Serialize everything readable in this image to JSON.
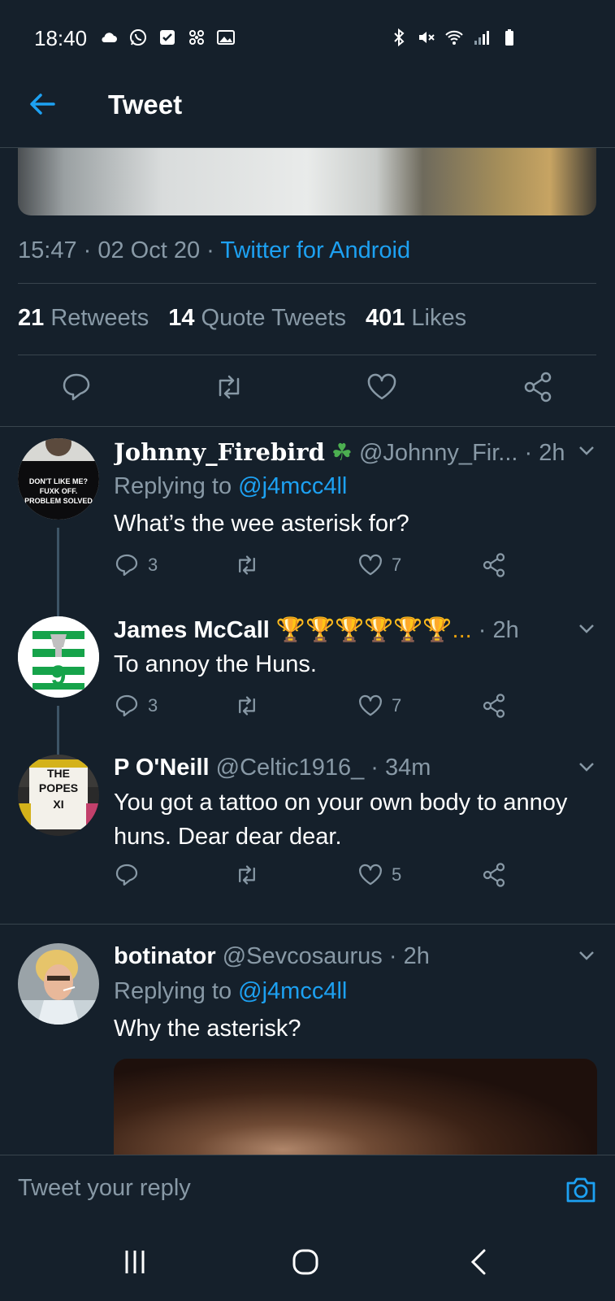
{
  "status_bar": {
    "time": "18:40",
    "left_icons": [
      "cloud-icon",
      "whatsapp-icon",
      "check-box-icon",
      "pinwheel-icon",
      "image-icon"
    ],
    "right_icons": [
      "bluetooth-icon",
      "mute-icon",
      "wifi-icon",
      "signal-icon",
      "battery-icon"
    ]
  },
  "header": {
    "title": "Tweet",
    "back_icon": "arrow-left-icon"
  },
  "tweet": {
    "time": "15:47",
    "sep1": " · ",
    "date": "02 Oct 20",
    "sep2": " · ",
    "source": "Twitter for Android",
    "stats": {
      "retweets_count": "21",
      "retweets_label": "Retweets",
      "quotes_count": "14",
      "quotes_label": "Quote Tweets",
      "likes_count": "401",
      "likes_label": "Likes"
    },
    "action_icons": [
      "reply-icon",
      "retweet-icon",
      "like-icon",
      "share-icon"
    ]
  },
  "replies": [
    {
      "name": "Johnny_Firebird",
      "name_emoji": "☘",
      "handle": "@Johnny_Fir...",
      "dot": " · ",
      "time": "2h",
      "replying_label": "Replying to",
      "replying_to": "@j4mcc4ll",
      "text": "What’s the wee asterisk for?",
      "reply_count": "3",
      "retweet_count": "",
      "like_count": "7",
      "avatar_text": [
        "DON'T LIKE ME?",
        "FUXK OFF.",
        "PROBLEM SOLVED"
      ]
    },
    {
      "name": "James McCall",
      "name_emoji": "🏆🏆🏆🏆🏆🏆...",
      "dot": " · ",
      "time": "2h",
      "text": "To annoy the Huns.",
      "reply_count": "3",
      "retweet_count": "",
      "like_count": "7"
    },
    {
      "name": "P O'Neill",
      "handle": "@Celtic1916_",
      "dot": " · ",
      "time": "34m",
      "text": "You got a tattoo on your own body to annoy huns. Dear dear dear.",
      "reply_count": "",
      "retweet_count": "",
      "like_count": "5",
      "avatar_text": [
        "THE",
        "POPES",
        "XI"
      ]
    },
    {
      "name": "botinator",
      "handle": "@Sevcosaurus",
      "dot": " · ",
      "time": "2h",
      "replying_label": "Replying to",
      "replying_to": "@j4mcc4ll",
      "text": "Why the asterisk?"
    }
  ],
  "reply_bar": {
    "placeholder": "Tweet your reply",
    "camera_icon": "camera-icon"
  },
  "nav_bar": {
    "icons": [
      "recent-apps-icon",
      "home-icon",
      "back-icon"
    ]
  },
  "colors": {
    "background": "#15202b",
    "accent": "#1da1f2",
    "muted": "#8899a6",
    "divider": "#38444d"
  }
}
